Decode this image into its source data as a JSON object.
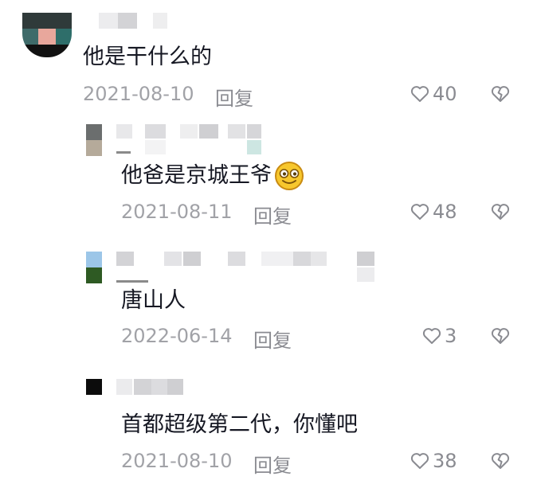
{
  "comments": [
    {
      "text": "他是干什么的",
      "date": "2021-08-10",
      "reply_label": "回复",
      "likes": "40",
      "icons": [
        "heart-icon",
        "broken-heart-icon"
      ]
    },
    {
      "text": "他爸是京城王爷",
      "emoji": "smiling-face-emoji",
      "date": "2021-08-11",
      "reply_label": "回复",
      "likes": "48",
      "icons": [
        "heart-icon",
        "broken-heart-icon"
      ]
    },
    {
      "text": "唐山人",
      "date": "2022-06-14",
      "reply_label": "回复",
      "likes": "3",
      "icons": [
        "heart-icon",
        "broken-heart-icon"
      ]
    },
    {
      "text": "首都超级第二代，你懂吧",
      "date": "2021-08-10",
      "reply_label": "回复",
      "likes": "38",
      "icons": [
        "heart-icon",
        "broken-heart-icon"
      ]
    }
  ],
  "colors": {
    "text": "#161823",
    "meta": "#a1a2a7",
    "icon": "#8a8b91",
    "blur": "#e3e3e6"
  }
}
